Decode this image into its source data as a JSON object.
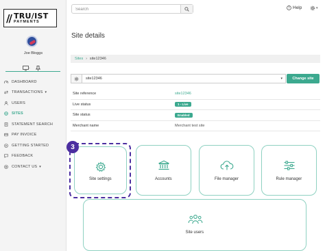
{
  "brand": {
    "logo_main": "TRU/IST",
    "logo_sub": "PAYMENTS"
  },
  "user": {
    "name": "Joe Bloggs"
  },
  "nav": {
    "items": [
      {
        "label": "DASHBOARD",
        "icon": "dashboard-icon"
      },
      {
        "label": "TRANSACTIONS",
        "icon": "transactions-icon",
        "has_caret": true
      },
      {
        "label": "USERS",
        "icon": "users-icon"
      },
      {
        "label": "SITES",
        "icon": "globe-icon",
        "active": true
      },
      {
        "label": "STATEMENT SEARCH",
        "icon": "statement-icon"
      },
      {
        "label": "PAY INVOICE",
        "icon": "invoice-icon"
      },
      {
        "label": "GETTING STARTED",
        "icon": "getting-started-icon"
      },
      {
        "label": "FEEDBACK",
        "icon": "feedback-icon"
      },
      {
        "label": "CONTACT US",
        "icon": "contact-icon",
        "has_caret": true
      }
    ],
    "caret": "▾"
  },
  "topbar": {
    "search_placeholder": "Search",
    "help_label": "Help"
  },
  "page": {
    "title": "Site details"
  },
  "breadcrumb": {
    "root": "Sites",
    "separator": "›",
    "current": "site12346"
  },
  "site_selector": {
    "value": "site12346",
    "button_label": "Change site"
  },
  "details": {
    "rows": [
      {
        "label": "Site reference",
        "value": "site12346",
        "kind": "link"
      },
      {
        "label": "Live status",
        "value": "1 - Live",
        "kind": "badge"
      },
      {
        "label": "Site status",
        "value": "Enabled",
        "kind": "badge"
      },
      {
        "label": "Merchant name",
        "value": "Merchant test site",
        "kind": "text"
      }
    ]
  },
  "tiles": [
    {
      "label": "Site settings",
      "icon": "gear-icon"
    },
    {
      "label": "Accounts",
      "icon": "bank-icon"
    },
    {
      "label": "File manager",
      "icon": "cloud-upload-icon"
    },
    {
      "label": "Rule manager",
      "icon": "sliders-icon"
    },
    {
      "label": "Site users",
      "icon": "users-group-icon"
    }
  ],
  "annotation": {
    "step": "3"
  },
  "colors": {
    "accent": "#3ca98f",
    "tile_border": "#8ed1c1",
    "highlight": "#4b2ea0",
    "sidebar_bg": "#f4f4f4"
  }
}
